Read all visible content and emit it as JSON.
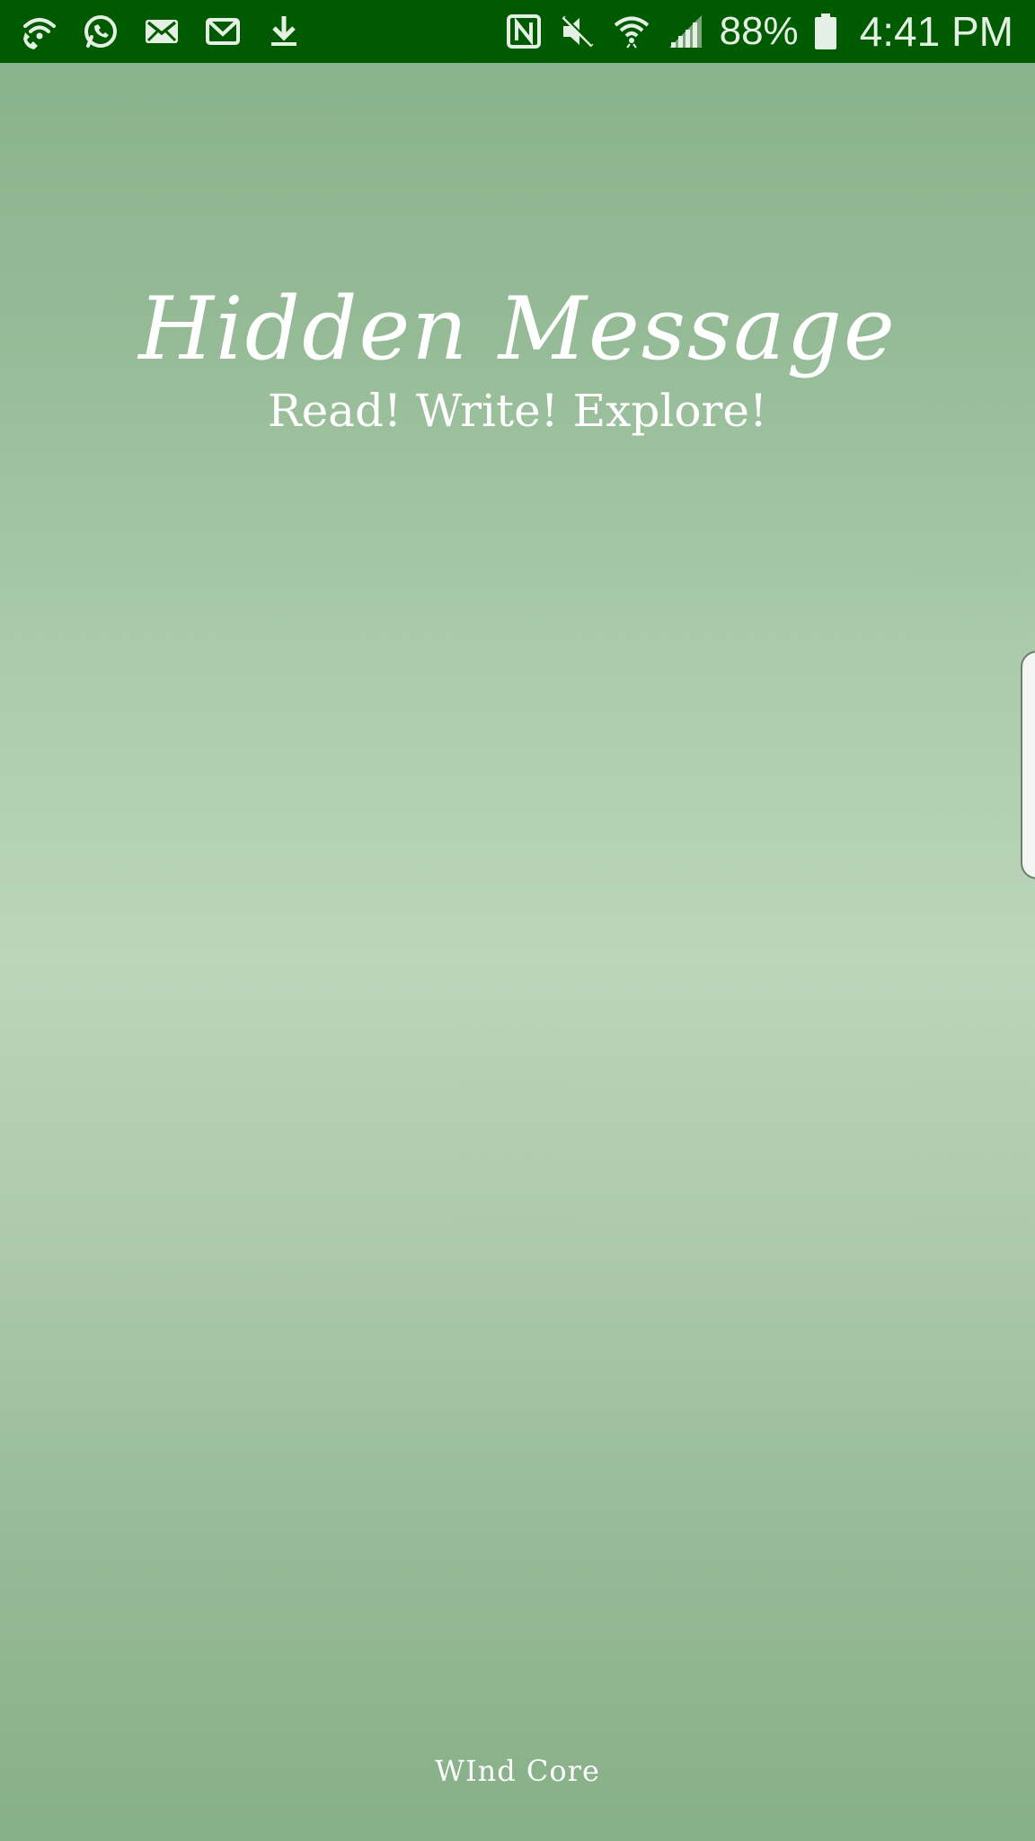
{
  "status_bar": {
    "left_icons": [
      "wifi-calling-icon",
      "whatsapp-icon",
      "email-icon",
      "gmail-icon",
      "download-icon"
    ],
    "right_icons": [
      "nfc-icon",
      "mute-icon",
      "wifi-icon",
      "signal-icon"
    ],
    "battery_percent": "88%",
    "time": "4:41 PM",
    "background_color": "#005a00"
  },
  "app": {
    "title": "Hidden Message",
    "tagline": "Read! Write! Explore!",
    "footer": "WInd Core"
  },
  "side_handle": {
    "icon": "edge-panel-handle"
  }
}
